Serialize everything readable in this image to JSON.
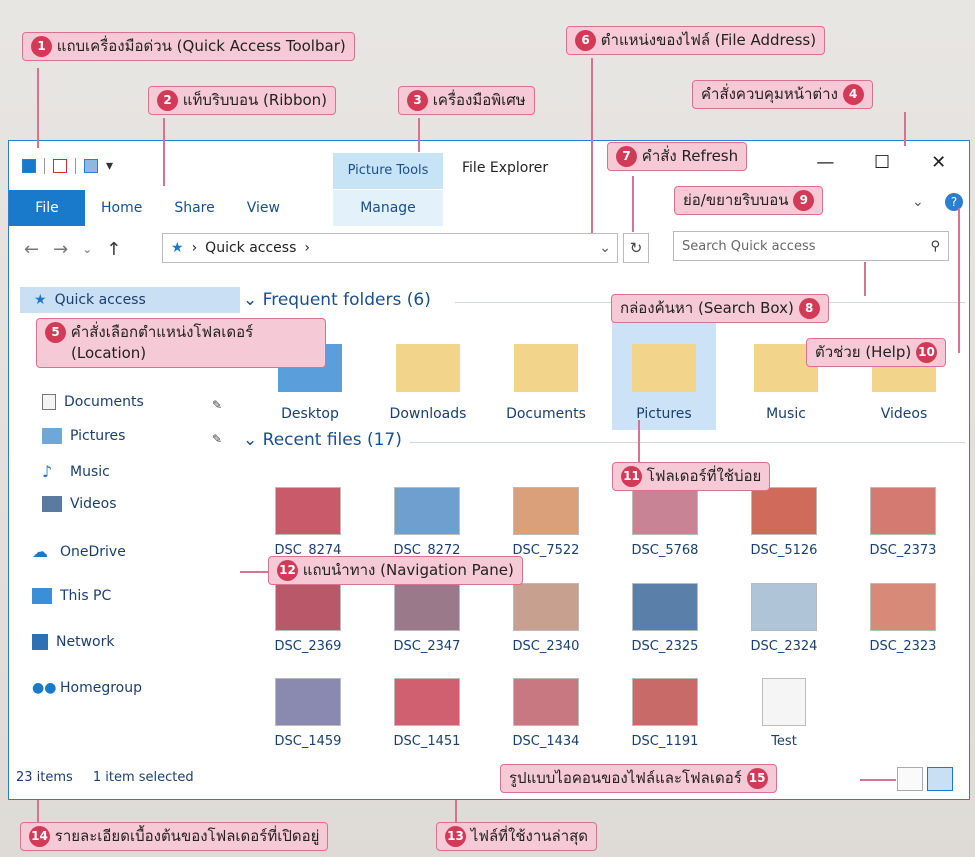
{
  "window": {
    "title": "File Explorer",
    "quick_access_toolbar": [
      "save-icon",
      "properties-icon",
      "new-folder-icon",
      "customize-dropdown-icon"
    ],
    "ribbon_tabs": [
      "File",
      "Home",
      "Share",
      "View"
    ],
    "contextual_tab_group": "Picture Tools",
    "contextual_tab": "Manage",
    "window_controls": [
      "—",
      "☐",
      "✕"
    ],
    "ribbon_toggle": "⌄",
    "help": "?"
  },
  "navigation": {
    "back": "←",
    "forward": "→",
    "recent": "⌄",
    "up": "↑",
    "address_path": "Quick access",
    "refresh": "↻",
    "search_placeholder": "Search Quick access"
  },
  "nav_pane": {
    "items": [
      {
        "label": "Quick access",
        "icon": "star-icon"
      },
      {
        "label": "Documents",
        "icon": "documents-icon",
        "pinned": true
      },
      {
        "label": "Pictures",
        "icon": "pictures-icon",
        "pinned": true
      },
      {
        "label": "Music",
        "icon": "music-icon"
      },
      {
        "label": "Videos",
        "icon": "videos-icon"
      },
      {
        "label": "OneDrive",
        "icon": "onedrive-icon"
      },
      {
        "label": "This PC",
        "icon": "this-pc-icon"
      },
      {
        "label": "Network",
        "icon": "network-icon"
      },
      {
        "label": "Homegroup",
        "icon": "homegroup-icon"
      }
    ]
  },
  "frequent": {
    "heading": "Frequent folders (6)",
    "folders": [
      "Desktop",
      "Downloads",
      "Documents",
      "Pictures",
      "Music",
      "Videos"
    ]
  },
  "recent": {
    "heading": "Recent files (17)",
    "files": [
      "DSC_8274",
      "DSC_8272",
      "DSC_7522",
      "DSC_5768",
      "DSC_5126",
      "DSC_2373",
      "DSC_2369",
      "DSC_2347",
      "DSC_2340",
      "DSC_2325",
      "DSC_2324",
      "DSC_2323",
      "DSC_1459",
      "DSC_1451",
      "DSC_1434",
      "DSC_1191",
      "Test"
    ]
  },
  "status": {
    "items": "23 items",
    "selected": "1 item selected"
  },
  "callouts": [
    {
      "n": "1",
      "text": "แถบเครื่องมือด่วน (Quick Access Toolbar)"
    },
    {
      "n": "2",
      "text": "แท็บริบบอน (Ribbon)"
    },
    {
      "n": "3",
      "text": "เครื่องมือพิเศษ"
    },
    {
      "n": "4",
      "text": "คำสั่งควบคุมหน้าต่าง"
    },
    {
      "n": "5",
      "text": "คำสั่งเลือกตำแหน่งโฟลเดอร์",
      "text2": "(Location)"
    },
    {
      "n": "6",
      "text": "ตำแหน่งของไฟล์ (File Address)"
    },
    {
      "n": "7",
      "text": "คำสั่ง Refresh"
    },
    {
      "n": "8",
      "text": "กล่องค้นหา (Search Box)"
    },
    {
      "n": "9",
      "text": "ย่อ/ขยายริบบอน"
    },
    {
      "n": "10",
      "text": "ตัวช่วย (Help)"
    },
    {
      "n": "11",
      "text": "โฟลเดอร์ที่ใช้บ่อย"
    },
    {
      "n": "12",
      "text": "แถบนำทาง (Navigation Pane)"
    },
    {
      "n": "13",
      "text": "ไฟล์ที่ใช้งานล่าสุด"
    },
    {
      "n": "14",
      "text": "รายละเอียดเบื้องต้นของโฟลเดอร์ที่เปิดอยู่"
    },
    {
      "n": "15",
      "text": "รูปแบบไอคอนของไฟล์และโฟลเดอร์"
    }
  ],
  "colors": {
    "accent": "#1979ca",
    "callout_bg": "#f6c9d7",
    "callout_num": "#d23b57",
    "selection": "#cce3f7"
  }
}
